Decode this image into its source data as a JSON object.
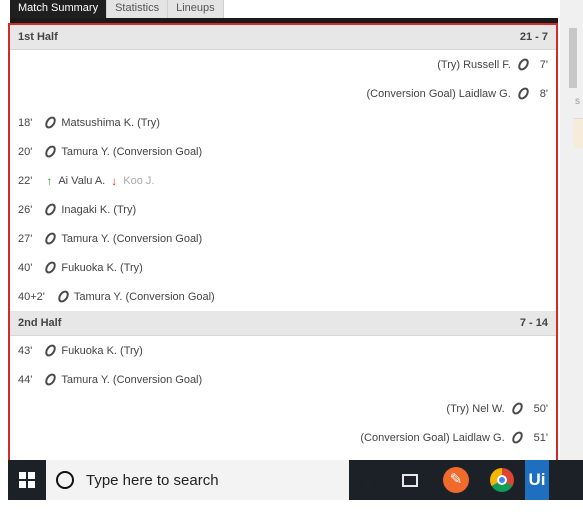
{
  "tabs": [
    {
      "label": "Match Summary",
      "active": true
    },
    {
      "label": "Statistics",
      "active": false
    },
    {
      "label": "Lineups",
      "active": false
    }
  ],
  "halves": [
    {
      "title": "1st Half",
      "score": "21 - 7",
      "events": [
        {
          "side": "away",
          "minute": "7'",
          "text": "(Try) Russell F.",
          "icon": "rugby-ball-icon"
        },
        {
          "side": "away",
          "minute": "8'",
          "text": "(Conversion Goal) Laidlaw G.",
          "icon": "rugby-ball-icon"
        },
        {
          "side": "home",
          "minute": "18'",
          "text": "Matsushima K. (Try)",
          "icon": "rugby-ball-icon"
        },
        {
          "side": "home",
          "minute": "20'",
          "text": "Tamura Y. (Conversion Goal)",
          "icon": "rugby-ball-icon"
        },
        {
          "side": "home",
          "minute": "22'",
          "type": "sub",
          "player_in": "Ai Valu A.",
          "player_out": "Koo J."
        },
        {
          "side": "home",
          "minute": "26'",
          "text": "Inagaki K. (Try)",
          "icon": "rugby-ball-icon"
        },
        {
          "side": "home",
          "minute": "27'",
          "text": "Tamura Y. (Conversion Goal)",
          "icon": "rugby-ball-icon"
        },
        {
          "side": "home",
          "minute": "40'",
          "text": "Fukuoka K. (Try)",
          "icon": "rugby-ball-icon"
        },
        {
          "side": "home",
          "minute": "40+2'",
          "text": "Tamura Y. (Conversion Goal)",
          "icon": "rugby-ball-icon"
        }
      ]
    },
    {
      "title": "2nd Half",
      "score": "7 - 14",
      "events": [
        {
          "side": "home",
          "minute": "43'",
          "text": "Fukuoka K. (Try)",
          "icon": "rugby-ball-icon"
        },
        {
          "side": "home",
          "minute": "44'",
          "text": "Tamura Y. (Conversion Goal)",
          "icon": "rugby-ball-icon"
        },
        {
          "side": "away",
          "minute": "50'",
          "text": "(Try) Nel W.",
          "icon": "rugby-ball-icon"
        },
        {
          "side": "away",
          "minute": "51'",
          "text": "(Conversion Goal) Laidlaw G.",
          "icon": "rugby-ball-icon"
        }
      ]
    }
  ],
  "taskbar": {
    "search_placeholder": "Type here to search",
    "icons": [
      "windows-start-icon",
      "search-circle-icon",
      "microphone-icon",
      "task-view-icon",
      "pen-app-icon",
      "chrome-icon",
      "ui-app-icon"
    ],
    "ui_label": "Ui"
  },
  "peek": {
    "text": "s"
  },
  "colors": {
    "highlight_border": "#d52a2a",
    "sub_in": "#2aa52a",
    "sub_out": "#d52a2a",
    "taskbar": "#1c2027"
  }
}
